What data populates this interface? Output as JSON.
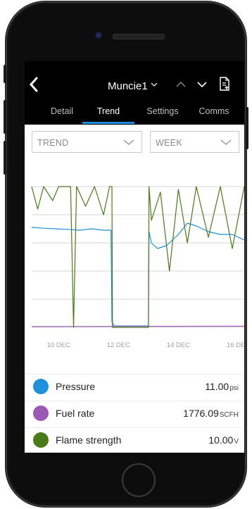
{
  "header": {
    "site_name": "Muncie1",
    "site_caret": "⌄"
  },
  "tabs": [
    {
      "label": "Detail",
      "active": false
    },
    {
      "label": "Trend",
      "active": true
    },
    {
      "label": "Settings",
      "active": false
    },
    {
      "label": "Comms",
      "active": false
    }
  ],
  "filters": {
    "metric_select": "TREND",
    "range_select": "WEEK"
  },
  "colors": {
    "accent": "#1e8fe0",
    "pressure": "#1e90dc",
    "fuel_rate": "#9b59b6",
    "flame_strength": "#4a7a1a"
  },
  "chart_data": {
    "type": "line",
    "x_ticks": [
      "10 DEC",
      "12 DEC",
      "14 DEC",
      "16 DEC"
    ],
    "xlim": [
      9.1,
      16.2
    ],
    "ylim": [
      0,
      5
    ],
    "grid": true,
    "legend_placement": "bottom",
    "series": [
      {
        "name": "Pressure",
        "color": "#1e90dc",
        "x": [
          9.1,
          9.5,
          9.9,
          10.3,
          10.7,
          11.1,
          11.5,
          11.75,
          11.78,
          11.85,
          12.5,
          13.0,
          13.02,
          13.1,
          13.3,
          13.6,
          14.0,
          14.3,
          14.6,
          15.0,
          15.4,
          15.8,
          16.2
        ],
        "values": [
          3.55,
          3.52,
          3.5,
          3.48,
          3.45,
          3.5,
          3.45,
          3.45,
          0.2,
          0.05,
          0.05,
          0.05,
          3.4,
          3.0,
          2.8,
          2.9,
          3.3,
          3.7,
          3.6,
          3.4,
          3.3,
          3.3,
          3.1
        ]
      },
      {
        "name": "Fuel rate",
        "color": "#9b59b6",
        "x": [
          9.1,
          16.2
        ],
        "values": [
          0.03,
          0.04
        ]
      },
      {
        "name": "Flame strength",
        "color": "#4a7a1a",
        "x": [
          9.1,
          9.3,
          9.5,
          9.8,
          10.0,
          10.4,
          10.5,
          10.6,
          10.9,
          11.2,
          11.5,
          11.7,
          11.78,
          11.8,
          13.0,
          13.02,
          13.1,
          13.4,
          13.7,
          14.0,
          14.3,
          14.6,
          15.0,
          15.4,
          15.8,
          16.2
        ],
        "values": [
          5.0,
          4.2,
          5.0,
          4.5,
          5.0,
          5.0,
          0.0,
          5.0,
          4.3,
          5.0,
          4.0,
          5.0,
          5.0,
          0.0,
          0.0,
          5.0,
          3.8,
          4.8,
          2.0,
          4.9,
          3.0,
          5.0,
          3.2,
          5.0,
          2.8,
          5.0
        ]
      }
    ]
  },
  "legend": [
    {
      "name": "Pressure",
      "value": "11.00",
      "unit": "psi"
    },
    {
      "name": "Fuel rate",
      "value": "1776.09",
      "unit": "SCFH"
    },
    {
      "name": "Flame strength",
      "value": "10.00",
      "unit": "V"
    }
  ]
}
